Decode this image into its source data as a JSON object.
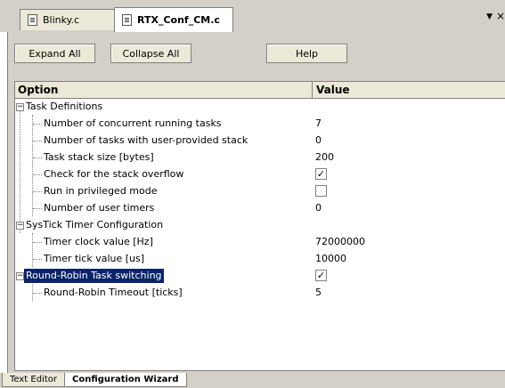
{
  "tabs": [
    {
      "label": "Blinky.c",
      "active": false
    },
    {
      "label": "RTX_Conf_CM.c",
      "active": true
    }
  ],
  "tab_controls": {
    "dropdown": "▼",
    "close": "×"
  },
  "toolbar": {
    "expand_all": "Expand All",
    "collapse_all": "Collapse All",
    "help": "Help"
  },
  "grid": {
    "headers": {
      "option": "Option",
      "value": "Value"
    },
    "groups": [
      {
        "label": "Task Definitions",
        "expander": "−",
        "items": [
          {
            "label": "Number of concurrent running tasks",
            "value": "7"
          },
          {
            "label": "Number of tasks with user-provided stack",
            "value": "0"
          },
          {
            "label": "Task stack size [bytes]",
            "value": "200"
          },
          {
            "label": "Check for the stack overflow",
            "checked": "✓"
          },
          {
            "label": "Run in privileged mode",
            "checked": ""
          },
          {
            "label": "Number of user timers",
            "value": "0"
          }
        ]
      },
      {
        "label": "SysTick Timer Configuration",
        "expander": "−",
        "items": [
          {
            "label": "Timer clock value [Hz]",
            "value": "72000000"
          },
          {
            "label": "Timer tick value [us]",
            "value": "10000"
          }
        ]
      },
      {
        "label": "Round-Robin Task switching",
        "expander": "−",
        "checked": "✓",
        "selected": true,
        "items": [
          {
            "label": "Round-Robin Timeout [ticks]",
            "value": "5"
          }
        ]
      }
    ]
  },
  "bottom_tabs": [
    {
      "label": "Text Editor",
      "active": false
    },
    {
      "label": "Configuration Wizard",
      "active": true
    }
  ],
  "colors": {
    "selection": "#0a246a",
    "panel": "#d4d0c8"
  }
}
